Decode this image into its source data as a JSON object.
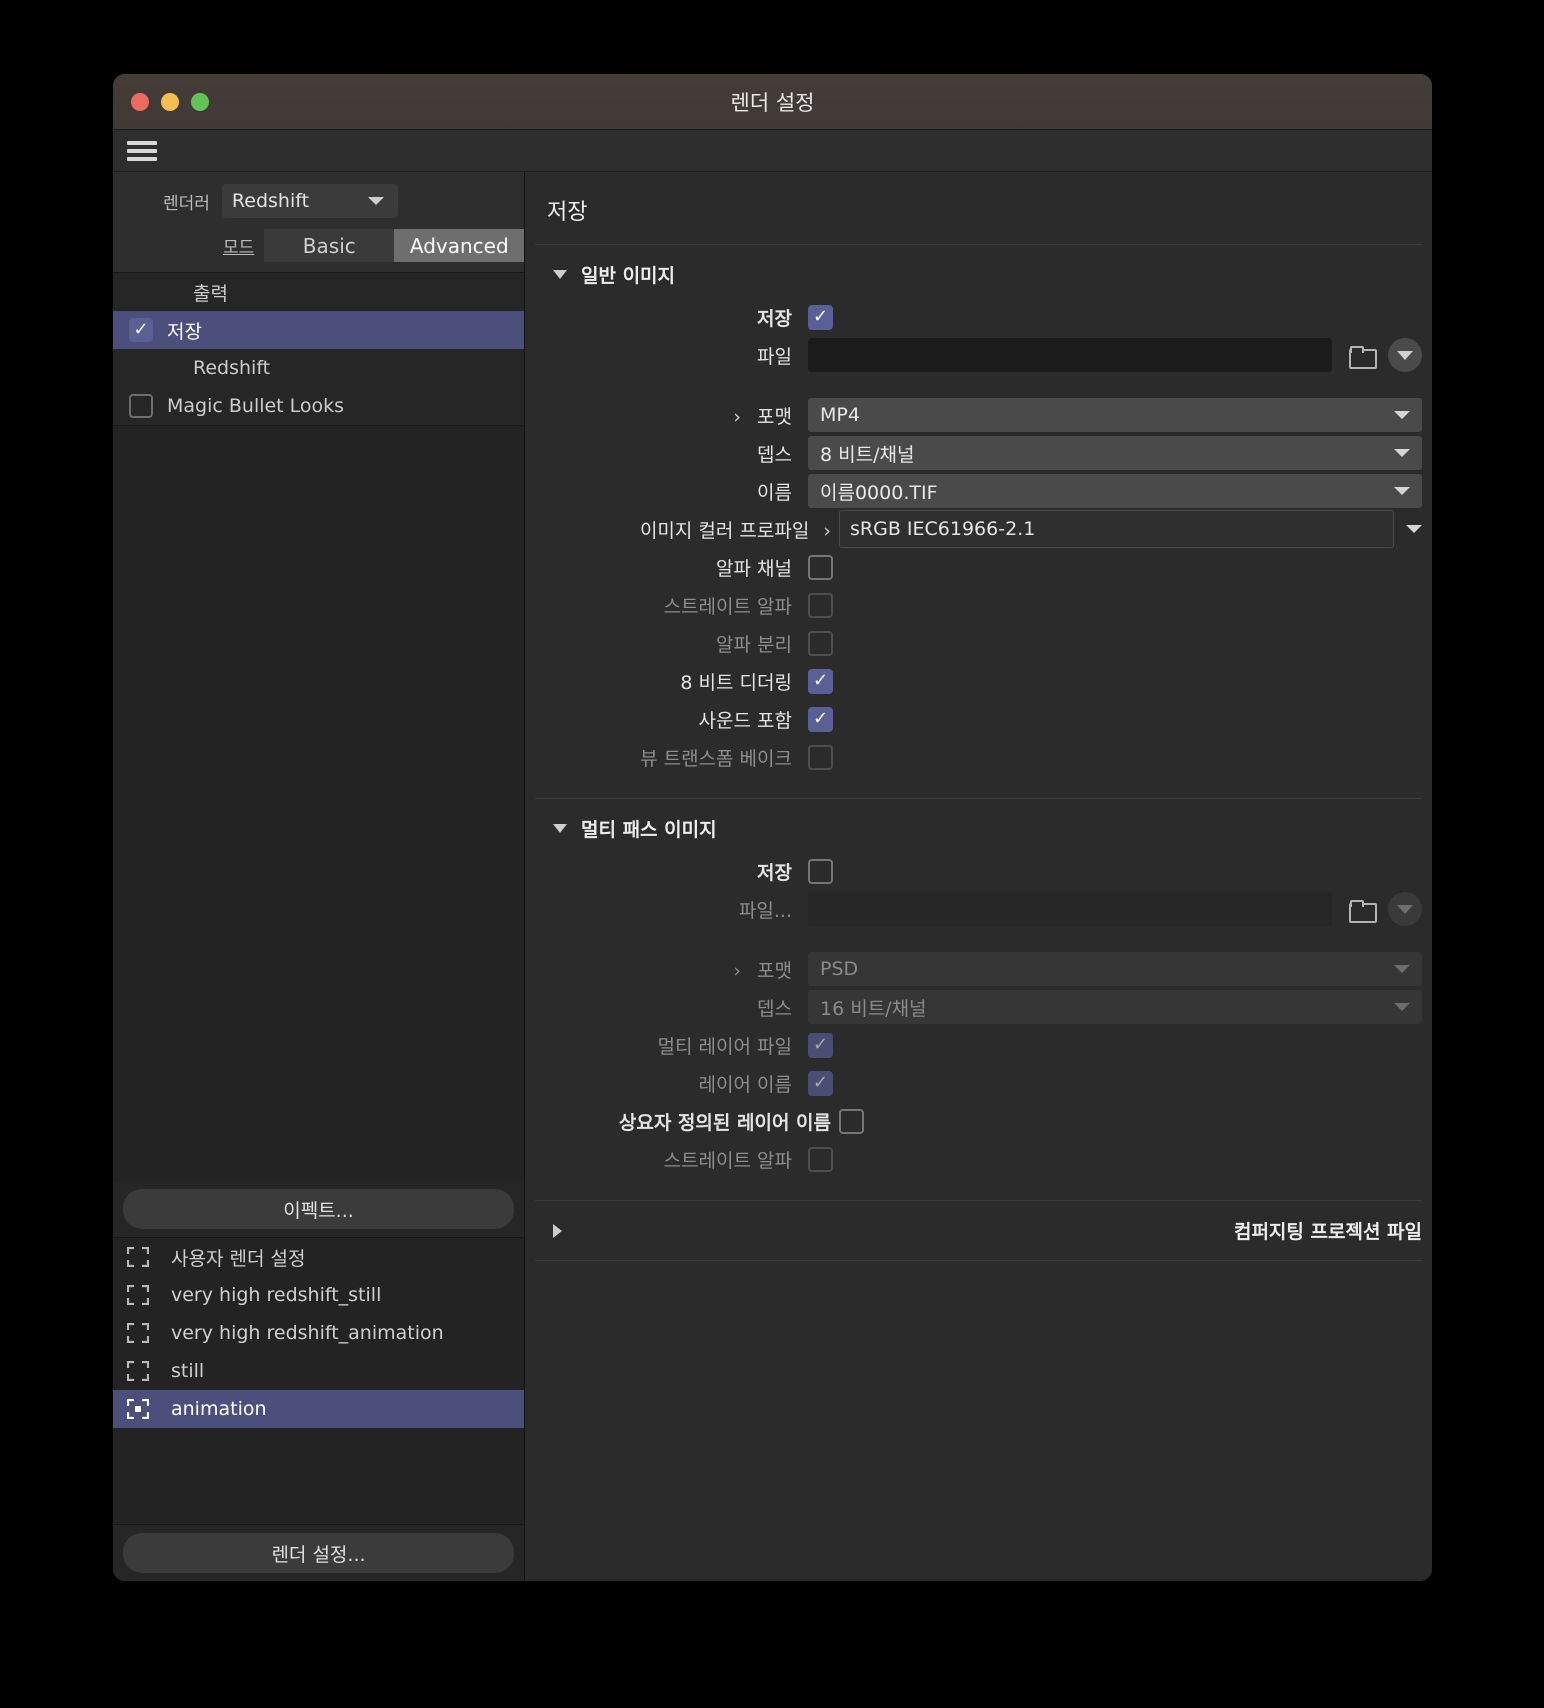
{
  "window": {
    "title": "렌더 설정"
  },
  "titlebar": {
    "close": "close-button",
    "minimize": "minimize-button",
    "zoom": "zoom-button"
  },
  "sidebar": {
    "renderer_label": "렌더러",
    "renderer_value": "Redshift",
    "mode_label": "모드",
    "mode_options": [
      "Basic",
      "Advanced"
    ],
    "mode_selected": "Advanced",
    "nav_items": [
      {
        "label": "출력",
        "checkbox": "none",
        "selected": false
      },
      {
        "label": "저장",
        "checkbox": "checked",
        "selected": true
      },
      {
        "label": "Redshift",
        "checkbox": "none",
        "selected": false
      },
      {
        "label": "Magic Bullet Looks",
        "checkbox": "unchecked",
        "selected": false
      }
    ],
    "effects_button": "이펙트...",
    "presets": [
      {
        "label": "사용자 렌더 설정",
        "selected": false
      },
      {
        "label": "very high redshift_still",
        "selected": false
      },
      {
        "label": "very high redshift_animation",
        "selected": false
      },
      {
        "label": "still",
        "selected": false
      },
      {
        "label": "animation",
        "selected": true
      }
    ],
    "render_settings_button": "렌더 설정..."
  },
  "panel": {
    "title": "저장",
    "regular_image": {
      "section_title": "일반 이미지",
      "expanded": true,
      "save_label": "저장",
      "save_checked": true,
      "file_label": "파일",
      "file_value": "",
      "format_label": "포맷",
      "format_value": "MP4",
      "depth_label": "뎁스",
      "depth_value": "8 비트/채널",
      "name_label": "이름",
      "name_value": "이름0000.TIF",
      "profile_label": "이미지 컬러 프로파일",
      "profile_value": "sRGB IEC61966-2.1",
      "checks": [
        {
          "label": "알파 채널",
          "checked": false,
          "enabled": true
        },
        {
          "label": "스트레이트 알파",
          "checked": false,
          "enabled": false
        },
        {
          "label": "알파 분리",
          "checked": false,
          "enabled": false
        },
        {
          "label": "8 비트 디더링",
          "checked": true,
          "enabled": true
        },
        {
          "label": "사운드 포함",
          "checked": true,
          "enabled": true
        },
        {
          "label": "뷰 트랜스폼 베이크",
          "checked": false,
          "enabled": false
        }
      ]
    },
    "multipass_image": {
      "section_title": "멀티 패스 이미지",
      "expanded": true,
      "save_label": "저장",
      "save_checked": false,
      "file_label": "파일...",
      "file_value": "",
      "format_label": "포맷",
      "format_value": "PSD",
      "depth_label": "뎁스",
      "depth_value": "16 비트/채널",
      "checks": [
        {
          "label": "멀티 레이어 파일",
          "checked": true,
          "enabled": false
        },
        {
          "label": "레이어 이름",
          "checked": true,
          "enabled": false
        },
        {
          "label": "상요자 정의된 레이어 이름",
          "checked": false,
          "enabled": true
        },
        {
          "label": "스트레이트 알파",
          "checked": false,
          "enabled": false
        }
      ]
    },
    "compositing": {
      "section_title": "컴퍼지팅 프로젝션 파일",
      "expanded": false
    }
  },
  "colors": {
    "accent_selection": "#4c4f7c",
    "accent_checkbox": "#5a5f96",
    "titlebar": "#453c38",
    "panel_bg": "#2b2b2b"
  }
}
